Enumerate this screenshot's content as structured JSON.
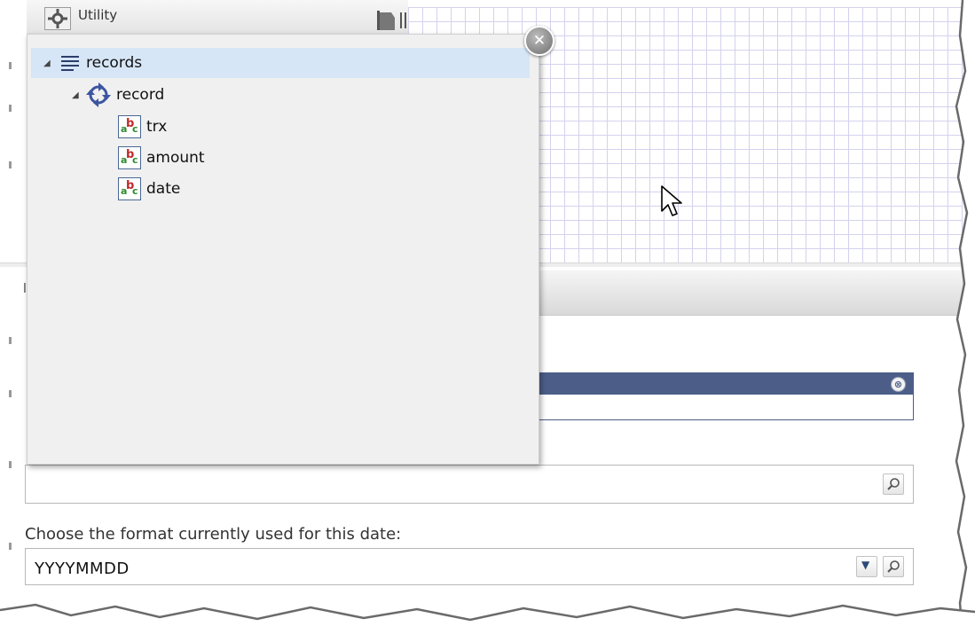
{
  "utility_bar": {
    "label": "Utility",
    "gear_icon": "gear-icon",
    "flag_icon": "flag-icon"
  },
  "tree": {
    "root": {
      "label": "records",
      "icon": "list-icon",
      "expanded": true,
      "selected": true
    },
    "record": {
      "label": "record",
      "icon": "cycle-icon",
      "expanded": true
    },
    "fields": [
      {
        "label": "trx",
        "icon": "abc-field-icon"
      },
      {
        "label": "amount",
        "icon": "abc-field-icon"
      },
      {
        "label": "date",
        "icon": "abc-field-icon"
      }
    ]
  },
  "popup_close_icon": "close-icon",
  "dialog_close_glyph": "⊗",
  "format": {
    "label": "Choose the format currently used for this date:",
    "value": "YYYYMMDD"
  },
  "search": {
    "value": ""
  },
  "colors": {
    "selection": "#d6e6f7",
    "dialog_header": "#4c5e88",
    "grid_line": "#d4d2ee",
    "popup_bg": "#f0f0f0"
  }
}
